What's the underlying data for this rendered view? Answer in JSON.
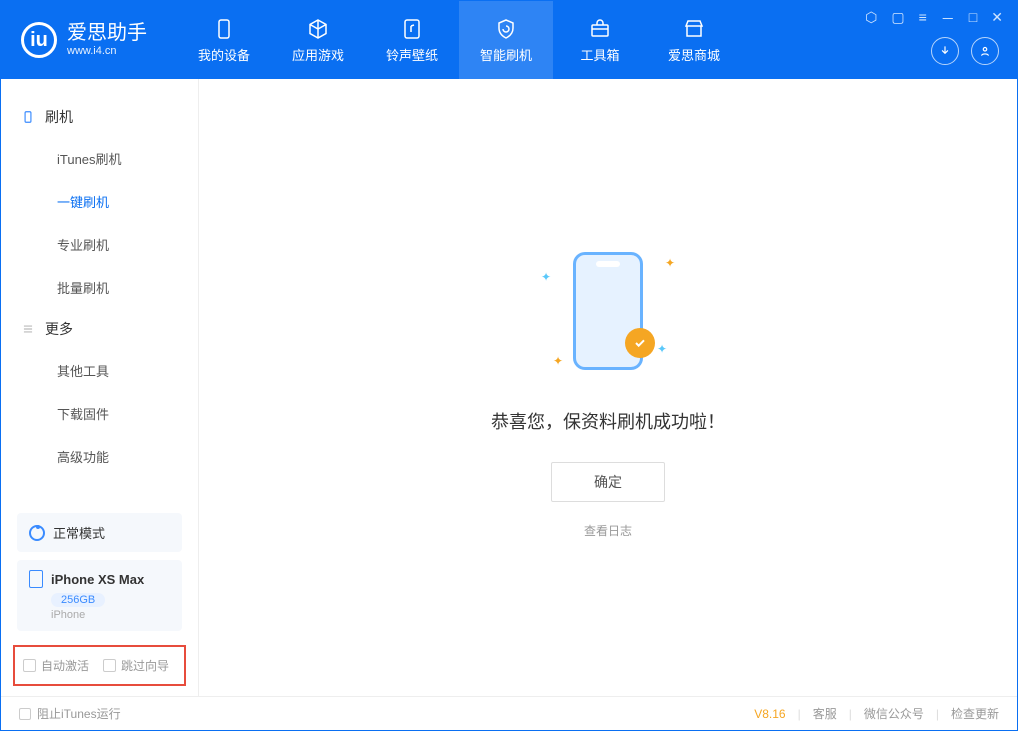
{
  "app": {
    "name": "爱思助手",
    "url": "www.i4.cn"
  },
  "nav": [
    {
      "label": "我的设备"
    },
    {
      "label": "应用游戏"
    },
    {
      "label": "铃声壁纸"
    },
    {
      "label": "智能刷机"
    },
    {
      "label": "工具箱"
    },
    {
      "label": "爱思商城"
    }
  ],
  "sidebar": {
    "group1": {
      "title": "刷机",
      "items": [
        "iTunes刷机",
        "一键刷机",
        "专业刷机",
        "批量刷机"
      ]
    },
    "group2": {
      "title": "更多",
      "items": [
        "其他工具",
        "下载固件",
        "高级功能"
      ]
    }
  },
  "device": {
    "mode": "正常模式",
    "name": "iPhone XS Max",
    "storage": "256GB",
    "type": "iPhone"
  },
  "options": {
    "auto_activate": "自动激活",
    "skip_guide": "跳过向导"
  },
  "main": {
    "success_text": "恭喜您，保资料刷机成功啦！",
    "ok_button": "确定",
    "view_log": "查看日志"
  },
  "statusbar": {
    "block_itunes": "阻止iTunes运行",
    "version": "V8.16",
    "support": "客服",
    "wechat": "微信公众号",
    "update": "检查更新"
  }
}
